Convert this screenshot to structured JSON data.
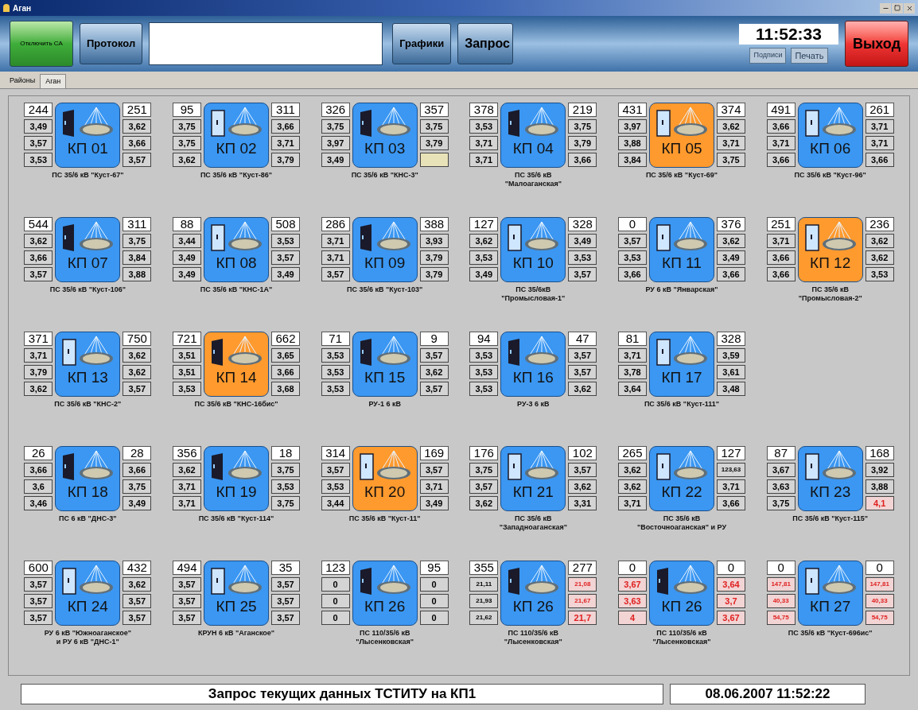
{
  "window": {
    "title": "Аган"
  },
  "toolbar": {
    "disconnect_button": "Отключить СА",
    "protocol_button": "Протокол",
    "charts_button": "Графики",
    "request_button": "Запрос",
    "clock": "11:52:33",
    "labels_button": "Подписи",
    "print_button": "Печать",
    "exit_button": "Выход"
  },
  "tabs": [
    {
      "label": "Районы",
      "selected": false
    },
    {
      "label": "Аган",
      "selected": true
    }
  ],
  "stations": [
    {
      "label": "КП 01",
      "alarm": false,
      "door_open": true,
      "caption": [
        "ПС 35/6 кВ \"Куст-67\""
      ],
      "left": [
        {
          "text": "244",
          "alarm": false
        },
        {
          "text": "3,49",
          "alarm": false
        },
        {
          "text": "3,57",
          "alarm": false
        },
        {
          "text": "3,53",
          "alarm": false
        }
      ],
      "right": [
        {
          "text": "251",
          "alarm": false
        },
        {
          "text": "3,62",
          "alarm": false
        },
        {
          "text": "3,66",
          "alarm": false
        },
        {
          "text": "3,57",
          "alarm": false
        }
      ]
    },
    {
      "label": "КП 02",
      "alarm": false,
      "door_open": false,
      "caption": [
        "ПС 35/6 кВ \"Куст-86\""
      ],
      "left": [
        {
          "text": "95",
          "alarm": false
        },
        {
          "text": "3,75",
          "alarm": false
        },
        {
          "text": "3,75",
          "alarm": false
        },
        {
          "text": "3,62",
          "alarm": false
        }
      ],
      "right": [
        {
          "text": "311",
          "alarm": false
        },
        {
          "text": "3,66",
          "alarm": false
        },
        {
          "text": "3,71",
          "alarm": false
        },
        {
          "text": "3,79",
          "alarm": false
        }
      ]
    },
    {
      "label": "КП 03",
      "alarm": false,
      "door_open": true,
      "caption": [
        "ПС 35/6 кВ \"КНС-3\""
      ],
      "left": [
        {
          "text": "326",
          "alarm": false
        },
        {
          "text": "3,75",
          "alarm": false
        },
        {
          "text": "3,97",
          "alarm": false
        },
        {
          "text": "3,49",
          "alarm": false
        }
      ],
      "right": [
        {
          "text": "357",
          "alarm": false
        },
        {
          "text": "3,75",
          "alarm": false
        },
        {
          "text": "3,79",
          "alarm": false
        },
        {
          "alarm": false
        }
      ]
    },
    {
      "label": "КП 04",
      "alarm": false,
      "door_open": true,
      "caption": [
        "ПС 35/6 кВ",
        "\"Малоаганская\""
      ],
      "left": [
        {
          "text": "378",
          "alarm": false
        },
        {
          "text": "3,53",
          "alarm": false
        },
        {
          "text": "3,71",
          "alarm": false
        },
        {
          "text": "3,71",
          "alarm": false
        }
      ],
      "right": [
        {
          "text": "219",
          "alarm": false
        },
        {
          "text": "3,75",
          "alarm": false
        },
        {
          "text": "3,79",
          "alarm": false
        },
        {
          "text": "3,66",
          "alarm": false
        }
      ]
    },
    {
      "label": "КП 05",
      "alarm": true,
      "door_open": false,
      "caption": [
        "ПС 35/6 кВ \"Куст-69\""
      ],
      "left": [
        {
          "text": "431",
          "alarm": false
        },
        {
          "text": "3,97",
          "alarm": false
        },
        {
          "text": "3,88",
          "alarm": false
        },
        {
          "text": "3,84",
          "alarm": false
        }
      ],
      "right": [
        {
          "text": "374",
          "alarm": false
        },
        {
          "text": "3,62",
          "alarm": false
        },
        {
          "text": "3,71",
          "alarm": false
        },
        {
          "text": "3,75",
          "alarm": false
        }
      ]
    },
    {
      "label": "КП 06",
      "alarm": false,
      "door_open": false,
      "caption": [
        "ПС 35/6 кВ \"Куст-96\""
      ],
      "left": [
        {
          "text": "491",
          "alarm": false
        },
        {
          "text": "3,66",
          "alarm": false
        },
        {
          "text": "3,71",
          "alarm": false
        },
        {
          "text": "3,66",
          "alarm": false
        }
      ],
      "right": [
        {
          "text": "261",
          "alarm": false
        },
        {
          "text": "3,71",
          "alarm": false
        },
        {
          "text": "3,71",
          "alarm": false
        },
        {
          "text": "3,66",
          "alarm": false
        }
      ]
    },
    {
      "label": "КП 07",
      "alarm": false,
      "door_open": true,
      "caption": [
        "ПС 35/6 кВ \"Куст-106\""
      ],
      "left": [
        {
          "text": "544",
          "alarm": false
        },
        {
          "text": "3,62",
          "alarm": false
        },
        {
          "text": "3,66",
          "alarm": false
        },
        {
          "text": "3,57",
          "alarm": false
        }
      ],
      "right": [
        {
          "text": "311",
          "alarm": false
        },
        {
          "text": "3,75",
          "alarm": false
        },
        {
          "text": "3,84",
          "alarm": false
        },
        {
          "text": "3,88",
          "alarm": false
        }
      ]
    },
    {
      "label": "КП 08",
      "alarm": false,
      "door_open": false,
      "caption": [
        "ПС 35/6 кВ \"КНС-1А\""
      ],
      "left": [
        {
          "text": "88",
          "alarm": false
        },
        {
          "text": "3,44",
          "alarm": false
        },
        {
          "text": "3,49",
          "alarm": false
        },
        {
          "text": "3,49",
          "alarm": false
        }
      ],
      "right": [
        {
          "text": "508",
          "alarm": false
        },
        {
          "text": "3,53",
          "alarm": false
        },
        {
          "text": "3,57",
          "alarm": false
        },
        {
          "text": "3,49",
          "alarm": false
        }
      ]
    },
    {
      "label": "КП 09",
      "alarm": false,
      "door_open": true,
      "caption": [
        "ПС 35/6 кВ \"Куст-103\""
      ],
      "left": [
        {
          "text": "286",
          "alarm": false
        },
        {
          "text": "3,71",
          "alarm": false
        },
        {
          "text": "3,71",
          "alarm": false
        },
        {
          "text": "3,57",
          "alarm": false
        }
      ],
      "right": [
        {
          "text": "388",
          "alarm": false
        },
        {
          "text": "3,93",
          "alarm": false
        },
        {
          "text": "3,79",
          "alarm": false
        },
        {
          "text": "3,79",
          "alarm": false
        }
      ]
    },
    {
      "label": "КП 10",
      "alarm": false,
      "door_open": false,
      "caption": [
        "ПС 35/6кВ",
        "\"Промысловая-1\""
      ],
      "left": [
        {
          "text": "127",
          "alarm": false
        },
        {
          "text": "3,62",
          "alarm": false
        },
        {
          "text": "3,53",
          "alarm": false
        },
        {
          "text": "3,49",
          "alarm": false
        }
      ],
      "right": [
        {
          "text": "328",
          "alarm": false
        },
        {
          "text": "3,49",
          "alarm": false
        },
        {
          "text": "3,53",
          "alarm": false
        },
        {
          "text": "3,57",
          "alarm": false
        }
      ]
    },
    {
      "label": "КП 11",
      "alarm": false,
      "door_open": false,
      "caption": [
        "РУ 6 кВ \"Январская\""
      ],
      "left": [
        {
          "text": "0",
          "alarm": false
        },
        {
          "text": "3,57",
          "alarm": false
        },
        {
          "text": "3,53",
          "alarm": false
        },
        {
          "text": "3,66",
          "alarm": false
        }
      ],
      "right": [
        {
          "text": "376",
          "alarm": false
        },
        {
          "text": "3,62",
          "alarm": false
        },
        {
          "text": "3,49",
          "alarm": false
        },
        {
          "text": "3,66",
          "alarm": false
        }
      ]
    },
    {
      "label": "КП 12",
      "alarm": true,
      "door_open": false,
      "caption": [
        "ПС 35/6 кВ",
        "\"Промысловая-2\""
      ],
      "left": [
        {
          "text": "251",
          "alarm": false
        },
        {
          "text": "3,71",
          "alarm": false
        },
        {
          "text": "3,66",
          "alarm": false
        },
        {
          "text": "3,66",
          "alarm": false
        }
      ],
      "right": [
        {
          "text": "236",
          "alarm": false
        },
        {
          "text": "3,62",
          "alarm": false
        },
        {
          "text": "3,62",
          "alarm": false
        },
        {
          "text": "3,53",
          "alarm": false
        }
      ]
    },
    {
      "label": "КП 13",
      "alarm": false,
      "door_open": false,
      "caption": [
        "ПС 35/6 кВ \"КНС-2\""
      ],
      "left": [
        {
          "text": "371",
          "alarm": false
        },
        {
          "text": "3,71",
          "alarm": false
        },
        {
          "text": "3,79",
          "alarm": false
        },
        {
          "text": "3,62",
          "alarm": false
        }
      ],
      "right": [
        {
          "text": "750",
          "alarm": false
        },
        {
          "text": "3,62",
          "alarm": false
        },
        {
          "text": "3,62",
          "alarm": false
        },
        {
          "text": "3,57",
          "alarm": false
        }
      ]
    },
    {
      "label": "КП 14",
      "alarm": true,
      "door_open": true,
      "caption": [
        "ПС 35/6 кВ \"КНС-16бис\""
      ],
      "left": [
        {
          "text": "721",
          "alarm": false
        },
        {
          "text": "3,51",
          "alarm": false
        },
        {
          "text": "3,51",
          "alarm": false
        },
        {
          "text": "3,53",
          "alarm": false
        }
      ],
      "right": [
        {
          "text": "662",
          "alarm": false
        },
        {
          "text": "3,65",
          "alarm": false
        },
        {
          "text": "3,66",
          "alarm": false
        },
        {
          "text": "3,68",
          "alarm": false
        }
      ]
    },
    {
      "label": "КП 15",
      "alarm": false,
      "door_open": true,
      "caption": [
        "РУ-1 6 кВ"
      ],
      "left": [
        {
          "text": "71",
          "alarm": false
        },
        {
          "text": "3,53",
          "alarm": false
        },
        {
          "text": "3,53",
          "alarm": false
        },
        {
          "text": "3,53",
          "alarm": false
        }
      ],
      "right": [
        {
          "text": "9",
          "alarm": false
        },
        {
          "text": "3,57",
          "alarm": false
        },
        {
          "text": "3,62",
          "alarm": false
        },
        {
          "text": "3,57",
          "alarm": false
        }
      ]
    },
    {
      "label": "КП 16",
      "alarm": false,
      "door_open": true,
      "caption": [
        "РУ-3 6 кВ"
      ],
      "left": [
        {
          "text": "94",
          "alarm": false
        },
        {
          "text": "3,53",
          "alarm": false
        },
        {
          "text": "3,53",
          "alarm": false
        },
        {
          "text": "3,53",
          "alarm": false
        }
      ],
      "right": [
        {
          "text": "47",
          "alarm": false
        },
        {
          "text": "3,57",
          "alarm": false
        },
        {
          "text": "3,57",
          "alarm": false
        },
        {
          "text": "3,62",
          "alarm": false
        }
      ]
    },
    {
      "label": "КП 17",
      "alarm": false,
      "door_open": false,
      "caption": [
        "ПС 35/6 кВ \"Куст-111\""
      ],
      "left": [
        {
          "text": "81",
          "alarm": false
        },
        {
          "text": "3,71",
          "alarm": false
        },
        {
          "text": "3,78",
          "alarm": false
        },
        {
          "text": "3,64",
          "alarm": false
        }
      ],
      "right": [
        {
          "text": "328",
          "alarm": false
        },
        {
          "text": "3,59",
          "alarm": false
        },
        {
          "text": "3,61",
          "alarm": false
        },
        {
          "text": "3,48",
          "alarm": false
        }
      ]
    },
    {
      "kind": "gap"
    },
    {
      "label": "КП 18",
      "alarm": false,
      "door_open": true,
      "caption": [
        "ПС 6 кВ \"ДНС-3\""
      ],
      "left": [
        {
          "text": "26",
          "alarm": false
        },
        {
          "text": "3,66",
          "alarm": false
        },
        {
          "text": "3,6",
          "alarm": false
        },
        {
          "text": "3,46",
          "alarm": false
        }
      ],
      "right": [
        {
          "text": "28",
          "alarm": false
        },
        {
          "text": "3,66",
          "alarm": false
        },
        {
          "text": "3,75",
          "alarm": false
        },
        {
          "text": "3,49",
          "alarm": false
        }
      ]
    },
    {
      "label": "КП 19",
      "alarm": false,
      "door_open": true,
      "caption": [
        "ПС 35/6 кВ \"Куст-114\""
      ],
      "left": [
        {
          "text": "356",
          "alarm": false
        },
        {
          "text": "3,62",
          "alarm": false
        },
        {
          "text": "3,71",
          "alarm": false
        },
        {
          "text": "3,71",
          "alarm": false
        }
      ],
      "right": [
        {
          "text": "18",
          "alarm": false
        },
        {
          "text": "3,75",
          "alarm": false
        },
        {
          "text": "3,53",
          "alarm": false
        },
        {
          "text": "3,75",
          "alarm": false
        }
      ]
    },
    {
      "label": "КП 20",
      "alarm": true,
      "door_open": false,
      "caption": [
        "ПС 35/6 кВ \"Куст-11\""
      ],
      "left": [
        {
          "text": "314",
          "alarm": false
        },
        {
          "text": "3,57",
          "alarm": false
        },
        {
          "text": "3,53",
          "alarm": false
        },
        {
          "text": "3,44",
          "alarm": false
        }
      ],
      "right": [
        {
          "text": "169",
          "alarm": false
        },
        {
          "text": "3,57",
          "alarm": false
        },
        {
          "text": "3,71",
          "alarm": false
        },
        {
          "text": "3,49",
          "alarm": false
        }
      ]
    },
    {
      "label": "КП 21",
      "alarm": false,
      "door_open": false,
      "caption": [
        "ПС 35/6 кВ",
        "\"Западноаганская\""
      ],
      "left": [
        {
          "text": "176",
          "alarm": false
        },
        {
          "text": "3,75",
          "alarm": false
        },
        {
          "text": "3,57",
          "alarm": false
        },
        {
          "text": "3,62",
          "alarm": false
        }
      ],
      "right": [
        {
          "text": "102",
          "alarm": false
        },
        {
          "text": "3,57",
          "alarm": false
        },
        {
          "text": "3,62",
          "alarm": false
        },
        {
          "text": "3,31",
          "alarm": false
        }
      ]
    },
    {
      "label": "КП 22",
      "alarm": false,
      "door_open": false,
      "caption": [
        "ПС 35/6 кВ",
        "\"Восточноаганская\" и РУ"
      ],
      "left": [
        {
          "text": "265",
          "alarm": false
        },
        {
          "text": "3,62",
          "alarm": false
        },
        {
          "text": "3,62",
          "alarm": false
        },
        {
          "text": "3,71",
          "alarm": false
        }
      ],
      "right": [
        {
          "text": "127",
          "alarm": false
        },
        {
          "text": "123,63",
          "alarm": false
        },
        {
          "text": "3,71",
          "alarm": false
        },
        {
          "text": "3,66",
          "alarm": false
        }
      ]
    },
    {
      "label": "КП 23",
      "alarm": false,
      "door_open": false,
      "caption": [
        "ПС 35/6 кВ \"Куст-115\""
      ],
      "left": [
        {
          "text": "87",
          "alarm": false
        },
        {
          "text": "3,67",
          "alarm": false
        },
        {
          "text": "3,63",
          "alarm": false
        },
        {
          "text": "3,75",
          "alarm": false
        }
      ],
      "right": [
        {
          "text": "168",
          "alarm": false
        },
        {
          "text": "3,92",
          "alarm": false
        },
        {
          "text": "3,88",
          "alarm": false
        },
        {
          "text": "4,1",
          "alarm": true
        }
      ]
    },
    {
      "label": "КП 24",
      "alarm": false,
      "door_open": false,
      "caption": [
        "РУ 6 кВ \"Южноаганское\"",
        "и РУ 6 кВ \"ДНС-1\""
      ],
      "left": [
        {
          "text": "600",
          "alarm": false
        },
        {
          "text": "3,57",
          "alarm": false
        },
        {
          "text": "3,57",
          "alarm": false
        },
        {
          "text": "3,57",
          "alarm": false
        }
      ],
      "right": [
        {
          "text": "432",
          "alarm": false
        },
        {
          "text": "3,62",
          "alarm": false
        },
        {
          "text": "3,57",
          "alarm": false
        },
        {
          "text": "3,57",
          "alarm": false
        }
      ]
    },
    {
      "label": "КП 25",
      "alarm": false,
      "door_open": false,
      "caption": [
        "КРУН 6 кВ \"Аганское\""
      ],
      "left": [
        {
          "text": "494",
          "alarm": false
        },
        {
          "text": "3,57",
          "alarm": false
        },
        {
          "text": "3,57",
          "alarm": false
        },
        {
          "text": "3,57",
          "alarm": false
        }
      ],
      "right": [
        {
          "text": "35",
          "alarm": false
        },
        {
          "text": "3,57",
          "alarm": false
        },
        {
          "text": "3,57",
          "alarm": false
        },
        {
          "text": "3,57",
          "alarm": false
        }
      ]
    },
    {
      "label": "КП 26",
      "alarm": false,
      "door_open": true,
      "caption": [
        "ПС 110/35/6 кВ",
        "\"Лысенковская\""
      ],
      "left": [
        {
          "text": "123",
          "alarm": false
        },
        {
          "text": "0",
          "alarm": false
        },
        {
          "text": "0",
          "alarm": false
        },
        {
          "text": "0",
          "alarm": false
        }
      ],
      "right": [
        {
          "text": "95",
          "alarm": false
        },
        {
          "text": "0",
          "alarm": false
        },
        {
          "text": "0",
          "alarm": false
        },
        {
          "text": "0",
          "alarm": false
        }
      ]
    },
    {
      "label": "КП 26",
      "alarm": false,
      "door_open": true,
      "caption": [
        "ПС 110/35/6 кВ",
        "\"Лысенковская\""
      ],
      "left": [
        {
          "text": "355",
          "alarm": false
        },
        {
          "text": "21,11",
          "alarm": false
        },
        {
          "text": "21,93",
          "alarm": false
        },
        {
          "text": "21,62",
          "alarm": false
        }
      ],
      "right": [
        {
          "text": "277",
          "alarm": false
        },
        {
          "text": "21,08",
          "alarm": true
        },
        {
          "text": "21,67",
          "alarm": true
        },
        {
          "text": "21,7",
          "alarm": true
        }
      ]
    },
    {
      "label": "КП 26",
      "alarm": false,
      "door_open": true,
      "caption": [
        "ПС 110/35/6 кВ",
        "\"Лысенковская\""
      ],
      "left": [
        {
          "text": "0",
          "alarm": false
        },
        {
          "text": "3,67",
          "alarm": true
        },
        {
          "text": "3,63",
          "alarm": true
        },
        {
          "text": "4",
          "alarm": true
        }
      ],
      "right": [
        {
          "text": "0",
          "alarm": false
        },
        {
          "text": "3,64",
          "alarm": true
        },
        {
          "text": "3,7",
          "alarm": true
        },
        {
          "text": "3,67",
          "alarm": true
        }
      ]
    },
    {
      "label": "КП 27",
      "alarm": false,
      "door_open": false,
      "caption": [
        "ПС 35/6 кВ \"Куст-696ис\""
      ],
      "left": [
        {
          "text": "0",
          "alarm": false
        },
        {
          "text": "147,81",
          "alarm": true
        },
        {
          "text": "40,33",
          "alarm": true
        },
        {
          "text": "54,75",
          "alarm": true
        }
      ],
      "right": [
        {
          "text": "0",
          "alarm": false
        },
        {
          "text": "147,81",
          "alarm": true
        },
        {
          "text": "40,33",
          "alarm": true
        },
        {
          "text": "54,75",
          "alarm": true
        }
      ]
    }
  ],
  "status_bar": {
    "message": "Запрос текущих данных ТСТИТУ на КП1",
    "timestamp": "08.06.2007 11:52:22"
  }
}
